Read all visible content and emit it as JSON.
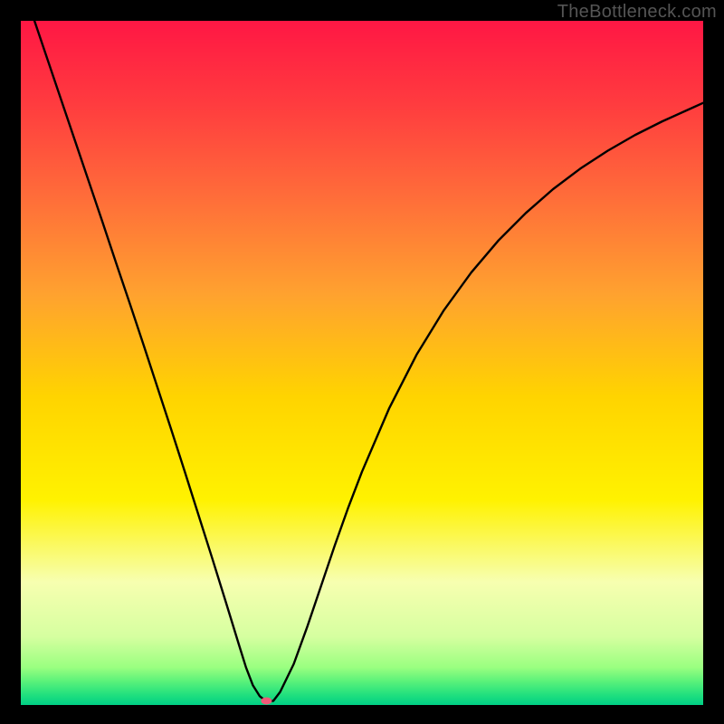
{
  "watermark": "TheBottleneck.com",
  "chart_data": {
    "type": "line",
    "title": "",
    "xlabel": "",
    "ylabel": "",
    "xlim": [
      0,
      100
    ],
    "ylim": [
      0,
      100
    ],
    "grid": false,
    "legend": false,
    "gradient_stops": [
      {
        "offset": 0.0,
        "color": "#ff1744"
      },
      {
        "offset": 0.12,
        "color": "#ff3b3f"
      },
      {
        "offset": 0.25,
        "color": "#ff6a3a"
      },
      {
        "offset": 0.4,
        "color": "#ffa22f"
      },
      {
        "offset": 0.55,
        "color": "#ffd400"
      },
      {
        "offset": 0.7,
        "color": "#fff200"
      },
      {
        "offset": 0.82,
        "color": "#f7ffb0"
      },
      {
        "offset": 0.9,
        "color": "#d6ffa0"
      },
      {
        "offset": 0.945,
        "color": "#9aff80"
      },
      {
        "offset": 0.965,
        "color": "#5cf27a"
      },
      {
        "offset": 0.985,
        "color": "#21e07e"
      },
      {
        "offset": 1.0,
        "color": "#00cf85"
      }
    ],
    "series": [
      {
        "name": "curve",
        "stroke": "#000000",
        "stroke_width": 2.4,
        "x": [
          2,
          4,
          6,
          8,
          10,
          12,
          14,
          16,
          18,
          20,
          22,
          24,
          26,
          28,
          30,
          32,
          33,
          34,
          35,
          36,
          37,
          38,
          40,
          42,
          44,
          46,
          48,
          50,
          54,
          58,
          62,
          66,
          70,
          74,
          78,
          82,
          86,
          90,
          94,
          98,
          100
        ],
        "y": [
          100,
          94.1,
          88.2,
          82.3,
          76.4,
          70.5,
          64.5,
          58.6,
          52.6,
          46.5,
          40.4,
          34.2,
          27.9,
          21.6,
          15.2,
          8.7,
          5.5,
          2.9,
          1.3,
          0.5,
          0.6,
          1.9,
          6.0,
          11.5,
          17.4,
          23.3,
          28.9,
          34.1,
          43.4,
          51.2,
          57.7,
          63.2,
          67.9,
          71.9,
          75.4,
          78.4,
          81.0,
          83.3,
          85.3,
          87.1,
          88.0
        ]
      }
    ],
    "marker": {
      "x": 36.0,
      "y": 0.6,
      "rx": 6,
      "ry": 4,
      "fill": "#ef5a78"
    }
  }
}
